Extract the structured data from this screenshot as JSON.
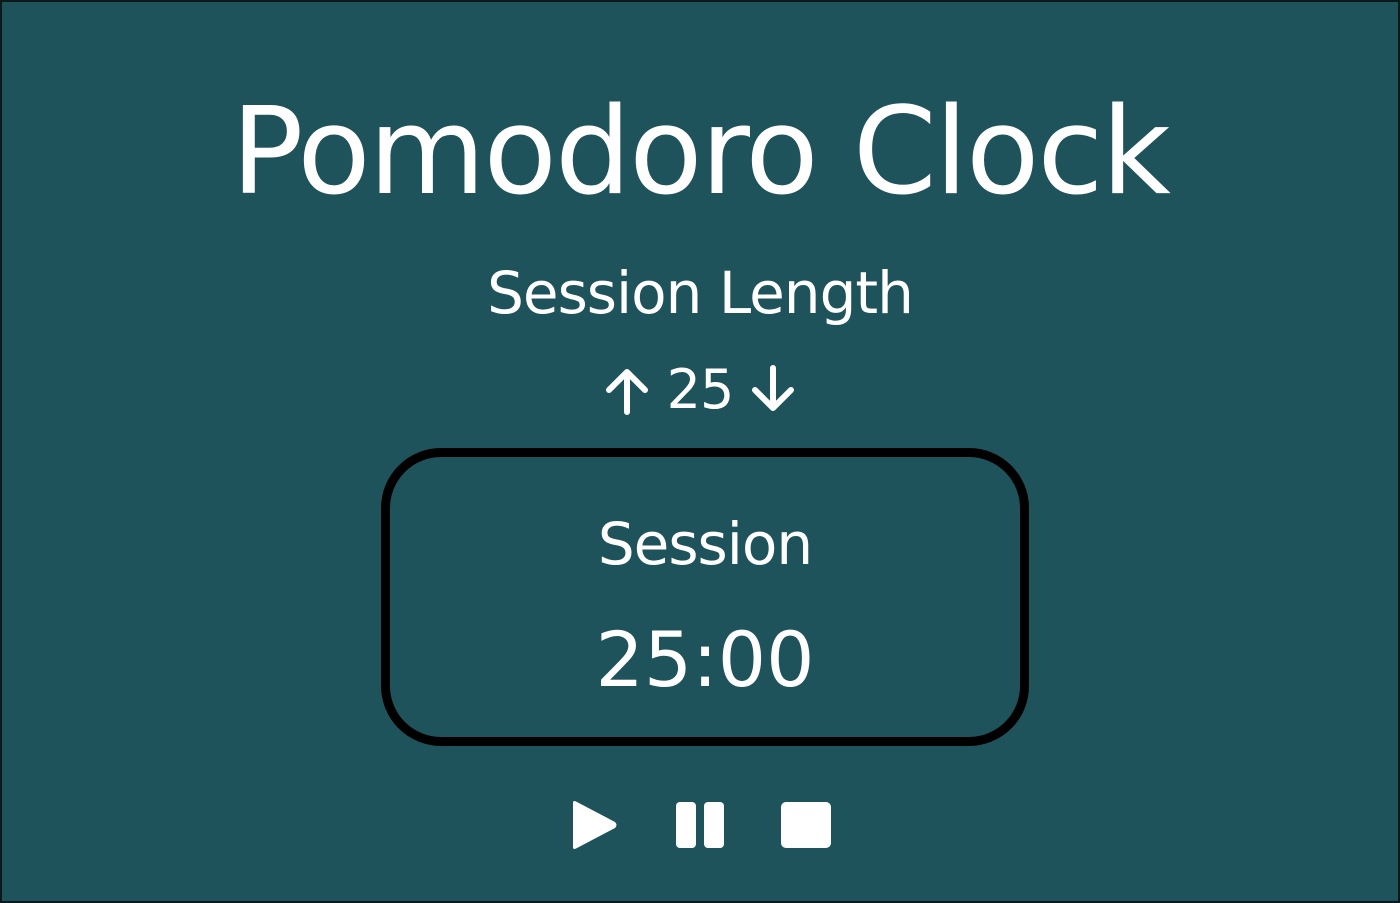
{
  "app": {
    "title": "Pomodoro Clock"
  },
  "session_length": {
    "label": "Session Length",
    "value": "25",
    "increment_icon": "arrow-up-icon",
    "decrement_icon": "arrow-down-icon"
  },
  "timer": {
    "label": "Session",
    "display": "25:00"
  },
  "controls": {
    "play_icon": "play-icon",
    "pause_icon": "pause-icon",
    "stop_icon": "stop-icon"
  },
  "colors": {
    "background": "#1f535b",
    "text": "#ffffff",
    "timer_border": "#000000"
  }
}
